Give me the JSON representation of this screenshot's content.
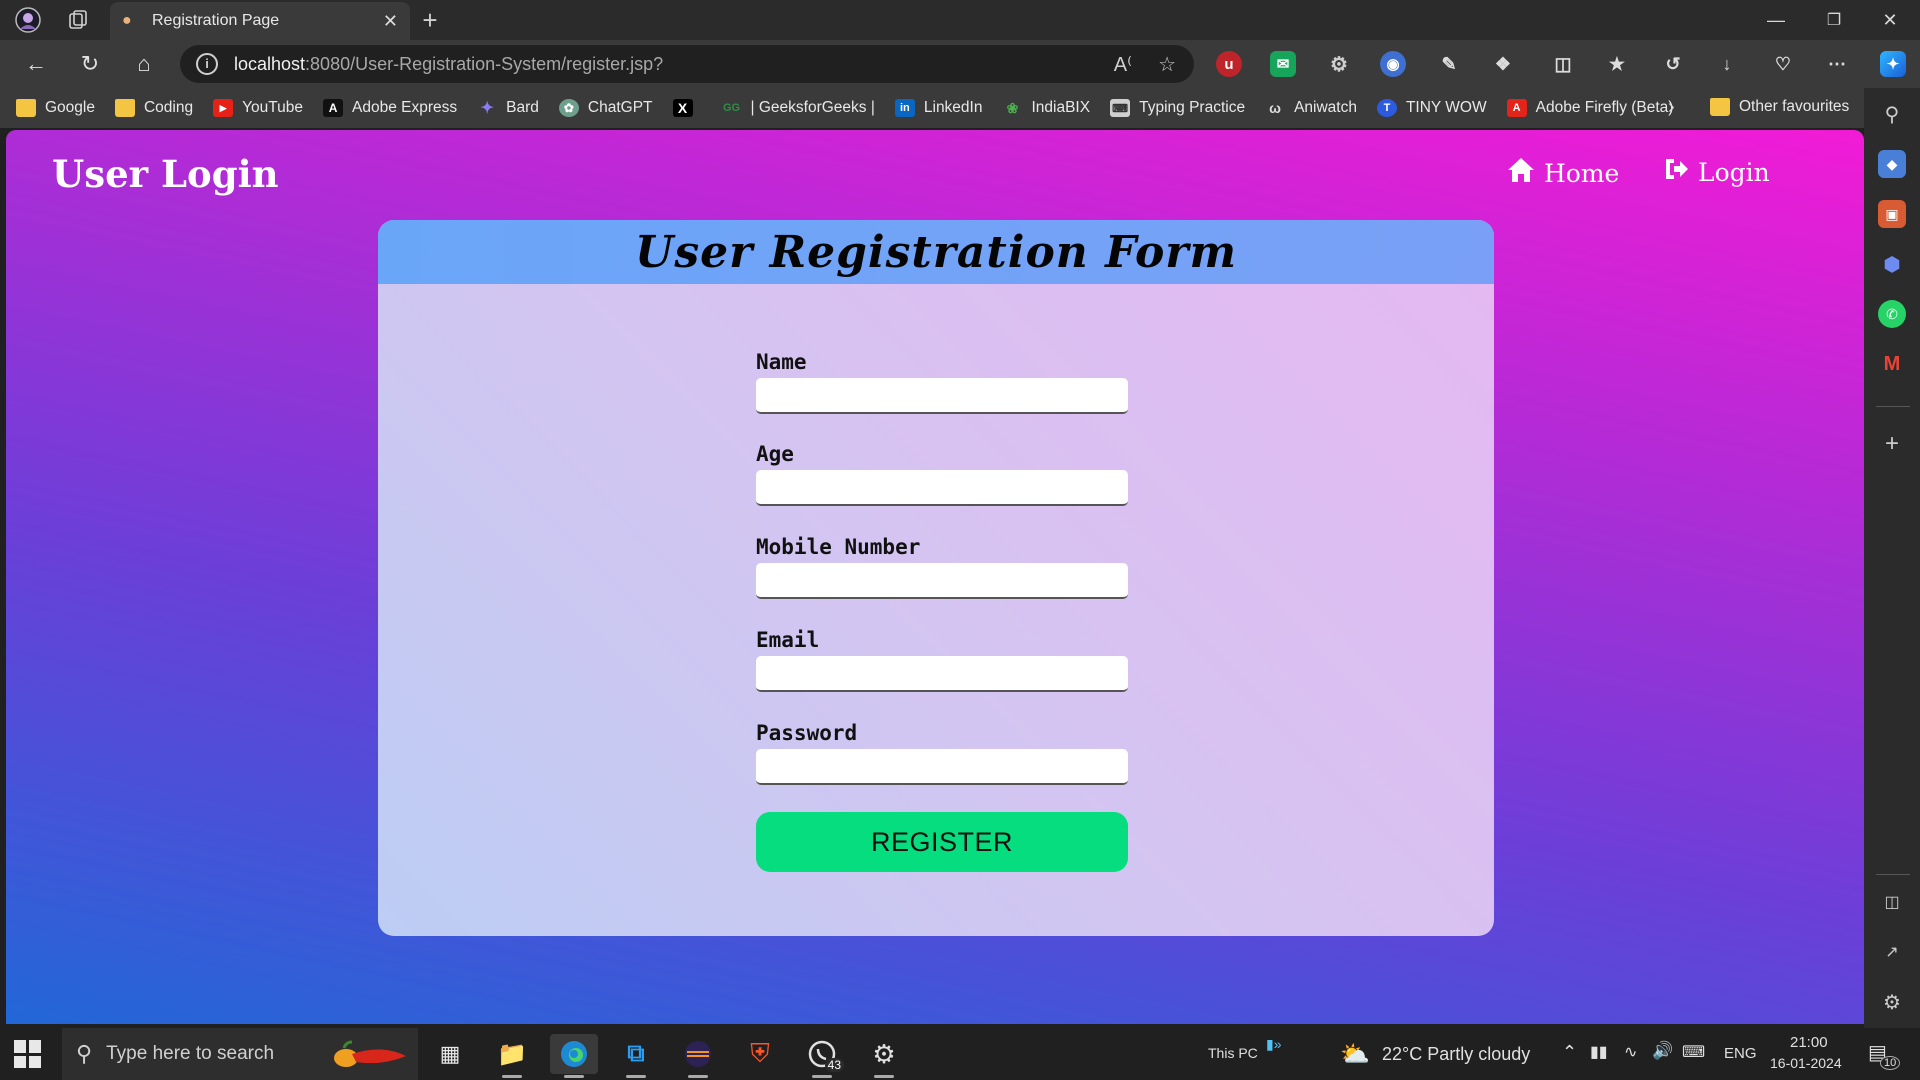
{
  "browser": {
    "tab_title": "Registration Page",
    "url_host": "localhost",
    "url_path": ":8080/User-Registration-System/register.jsp?",
    "bookmarks": [
      {
        "label": "Google",
        "icon": "folder-icon"
      },
      {
        "label": "Coding",
        "icon": "folder-icon"
      },
      {
        "label": "YouTube",
        "icon": "youtube-icon"
      },
      {
        "label": "Adobe Express",
        "icon": "adobe-express-icon"
      },
      {
        "label": "Bard",
        "icon": "bard-icon"
      },
      {
        "label": "ChatGPT",
        "icon": "chatgpt-icon"
      },
      {
        "label": "",
        "icon": "x-icon"
      },
      {
        "label": "| GeeksforGeeks |",
        "icon": "geeksforgeeks-icon"
      },
      {
        "label": "LinkedIn",
        "icon": "linkedin-icon"
      },
      {
        "label": "IndiaBIX",
        "icon": "indiabix-icon"
      },
      {
        "label": "Typing Practice",
        "icon": "typing-practice-icon"
      },
      {
        "label": "Aniwatch",
        "icon": "aniwatch-icon"
      },
      {
        "label": "TINY WOW",
        "icon": "tinywow-icon"
      },
      {
        "label": "Adobe Firefly (Beta)",
        "icon": "adobe-firefly-icon"
      }
    ],
    "other_favourites": "Other favourites"
  },
  "page": {
    "brand": "User Login",
    "nav": {
      "home": "Home",
      "login": "Login"
    },
    "form": {
      "title": "User Registration Form",
      "fields": [
        {
          "label": "Name",
          "value": ""
        },
        {
          "label": "Age",
          "value": ""
        },
        {
          "label": "Mobile Number",
          "value": ""
        },
        {
          "label": "Email",
          "value": ""
        },
        {
          "label": "Password",
          "value": ""
        }
      ],
      "submit_label": "REGISTER"
    }
  },
  "taskbar": {
    "search_placeholder": "Type here to search",
    "whatsapp_badge": "43",
    "this_pc": "This PC",
    "weather": "22°C  Partly cloudy",
    "language": "ENG",
    "time": "21:00",
    "date": "16-01-2024",
    "notifications": "10"
  },
  "colors": {
    "gradient_blue": "#2267d8",
    "gradient_pink": "#f21bd6",
    "form_header": "#6aa6f8",
    "register_button": "#05dd7f"
  }
}
